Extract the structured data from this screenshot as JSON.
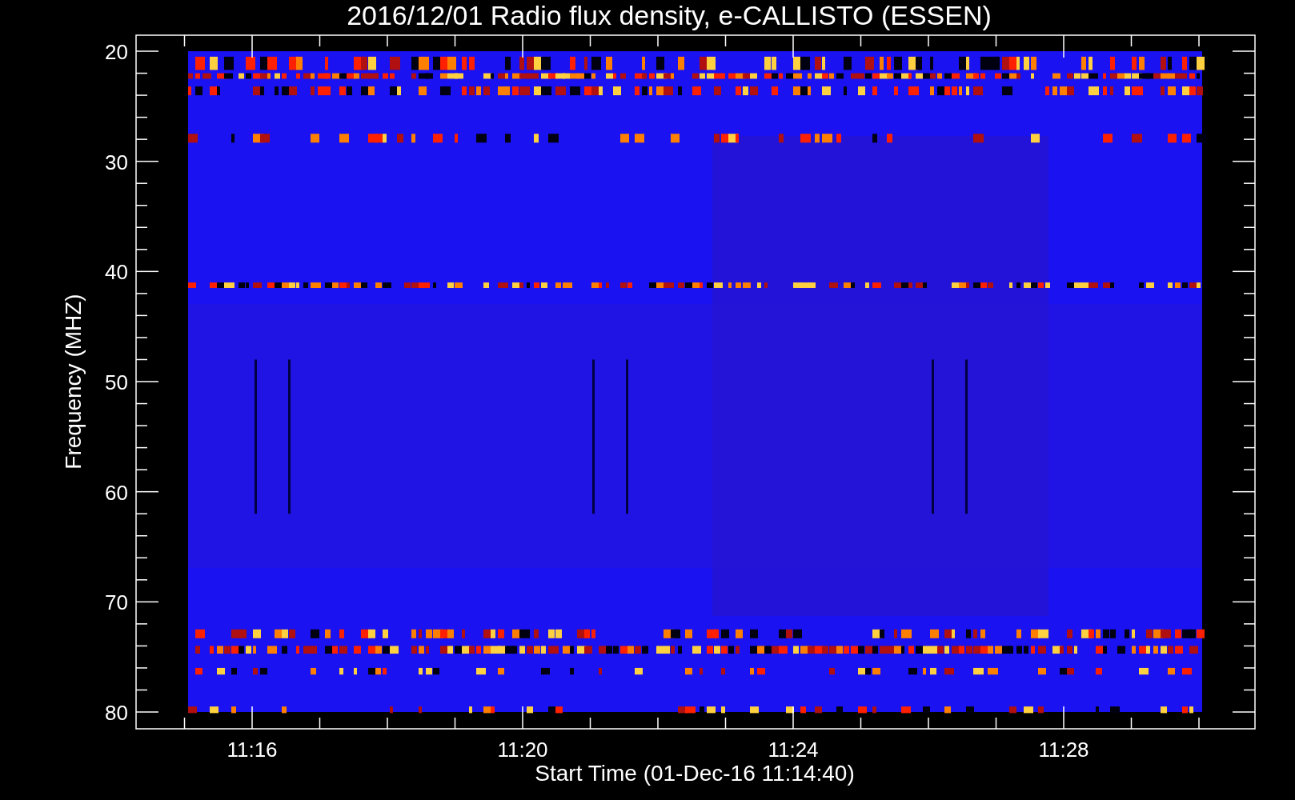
{
  "plot": {
    "title": "2016/12/01  Radio flux density, e-CALLISTO (ESSEN)",
    "xlabel": "Start Time (01-Dec-16 11:14:40)",
    "ylabel": "Frequency (MHZ)",
    "yticks": [
      "20",
      "30",
      "40",
      "50",
      "60",
      "70",
      "80"
    ],
    "xticks": [
      "11:16",
      "11:20",
      "11:24",
      "11:28"
    ]
  }
}
